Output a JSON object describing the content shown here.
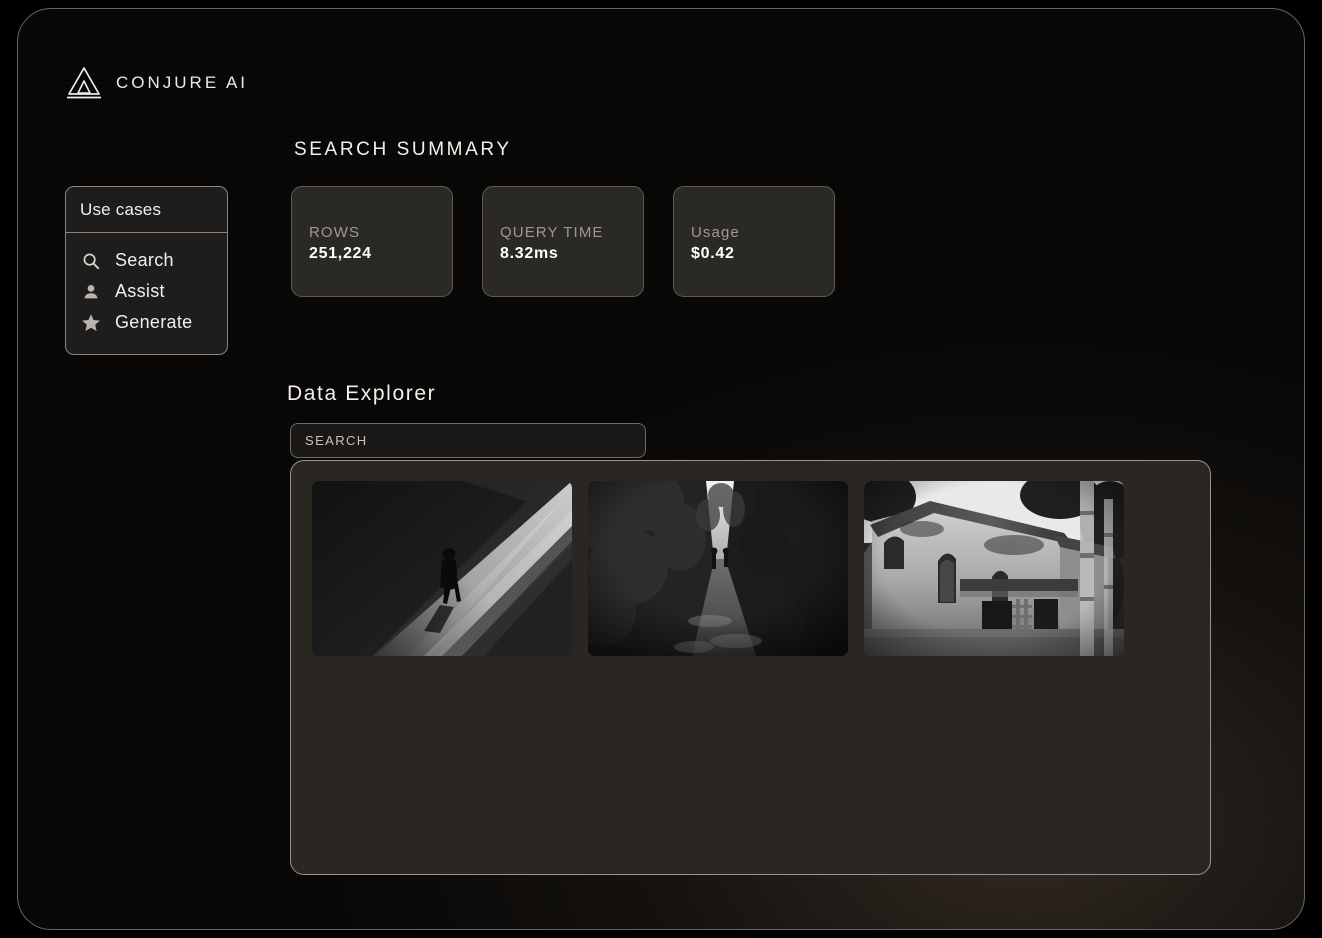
{
  "brand": {
    "logo_icon": "triangle-logo-icon",
    "name": "CONJURE AI"
  },
  "headings": {
    "search_summary": "SEARCH SUMMARY",
    "data_explorer": "Data Explorer"
  },
  "sidebar": {
    "header": "Use cases",
    "items": [
      {
        "label": "Search",
        "icon": "search-icon"
      },
      {
        "label": "Assist",
        "icon": "person-icon"
      },
      {
        "label": "Generate",
        "icon": "star-icon"
      }
    ]
  },
  "stats": [
    {
      "label": "ROWS",
      "value": "251,224"
    },
    {
      "label": "QUERY TIME",
      "value": "8.32ms"
    },
    {
      "label": "Usage",
      "value": "$0.42"
    }
  ],
  "search": {
    "placeholder": "SEARCH",
    "value": ""
  },
  "gallery": {
    "images": [
      {
        "alt": "Silhouette of a person walking on a diagonal shaft of light, black and white"
      },
      {
        "alt": "Tree-lined forest path receding into the distance, black and white"
      },
      {
        "alt": "Old weathered stone church building among trees, black and white"
      }
    ]
  },
  "colors": {
    "page_background": "#000000",
    "frame_background": "#080706",
    "frame_border": "#6a6560",
    "card_background": "#2b2926",
    "card_border": "#5f5a56",
    "gallery_background": "#2a2723",
    "gallery_border": "#9a938d",
    "text_primary": "#f2efec",
    "text_muted": "#9e9894"
  }
}
